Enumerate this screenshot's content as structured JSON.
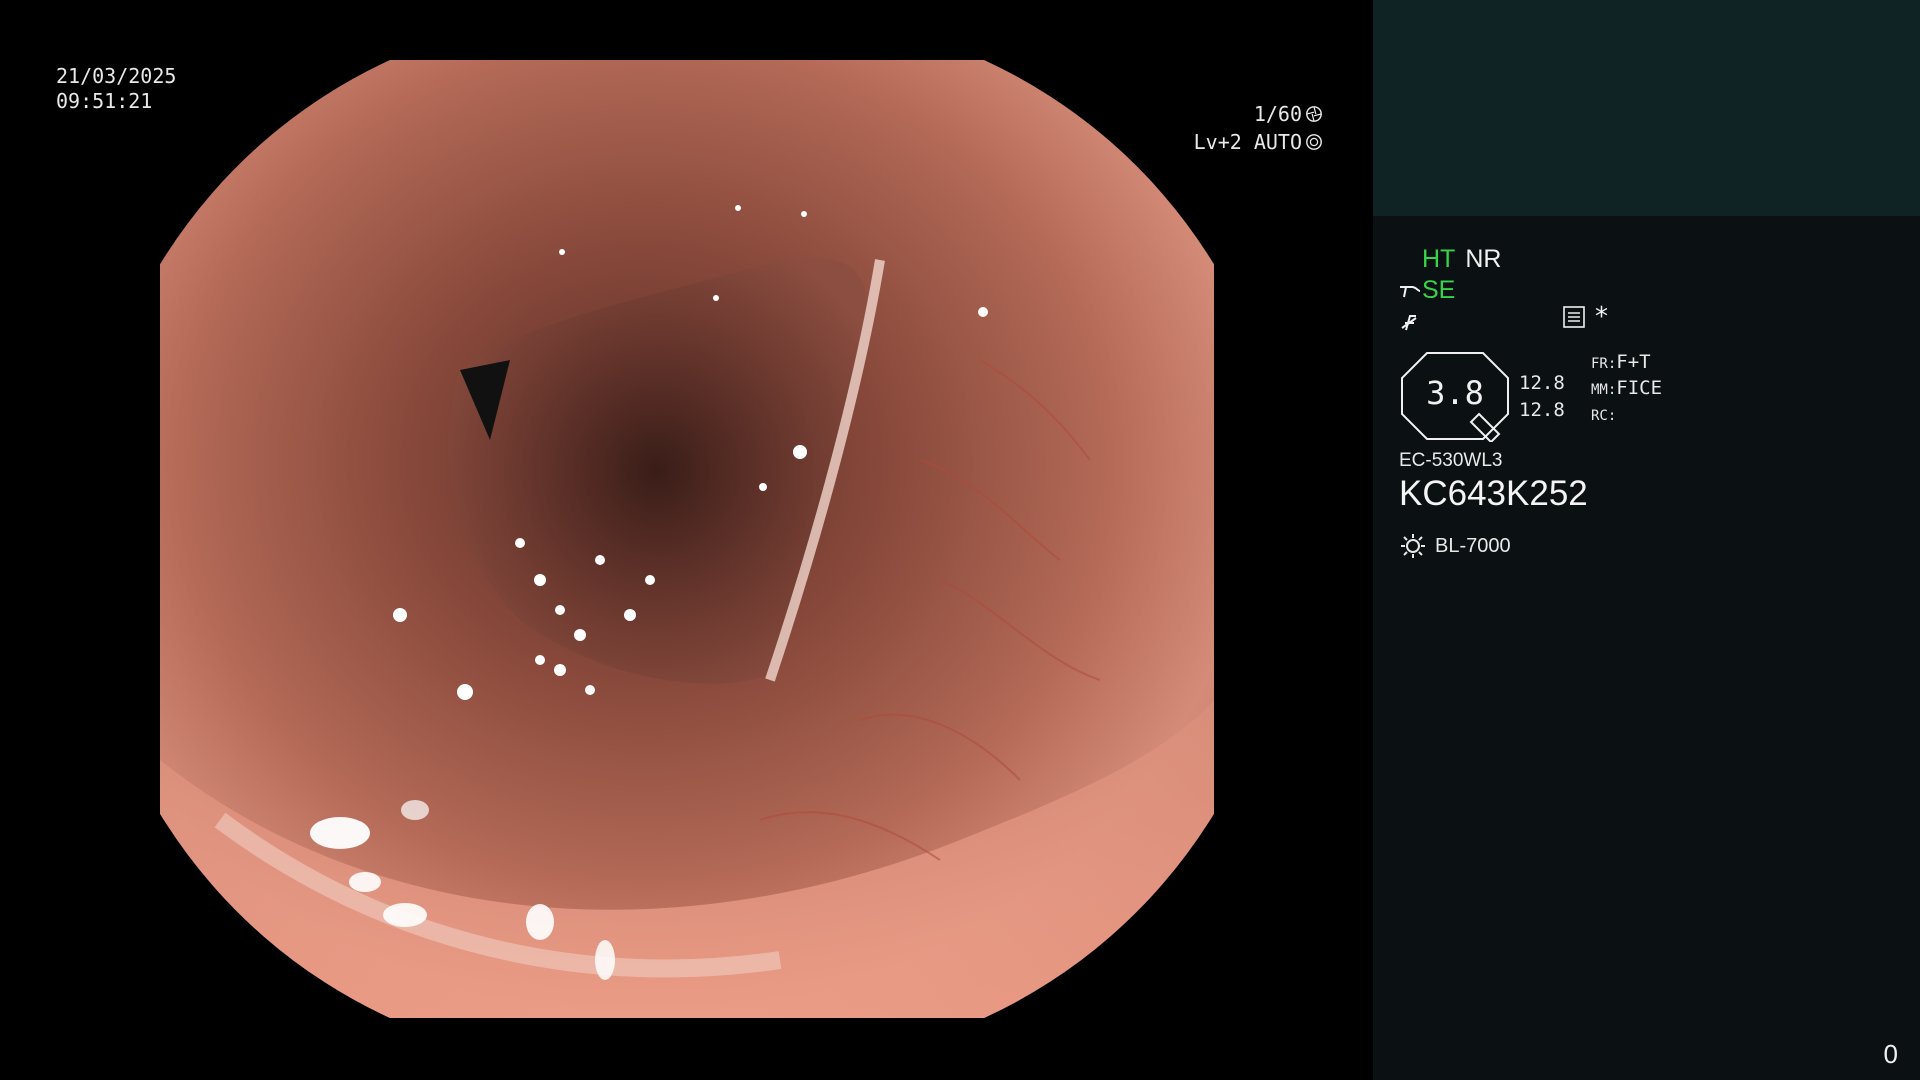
{
  "viewport": {
    "date": "21/03/2025",
    "time": "09:51:21",
    "shutter_speed": "1/60",
    "light_mode": "Lv+2 AUTO"
  },
  "panel": {
    "flag_ht": "HT",
    "flag_nr": "NR",
    "flag_se": "SE",
    "zoom_value": "3.8",
    "zoom_num_1": "12.8",
    "zoom_num_2": "12.8",
    "fr_label": "FR:",
    "fr_value": "F+T",
    "mm_label": "MM:",
    "mm_value": "FICE",
    "rc_label": "RC:",
    "scope_model": "EC-530WL3",
    "serial": "KC643K252",
    "light_source": "BL-7000",
    "star": "*",
    "counter": "0"
  },
  "colors": {
    "status_green": "#37d44a",
    "panel_bg": "#0b1113",
    "panel_top_bg": "#0f2224"
  }
}
